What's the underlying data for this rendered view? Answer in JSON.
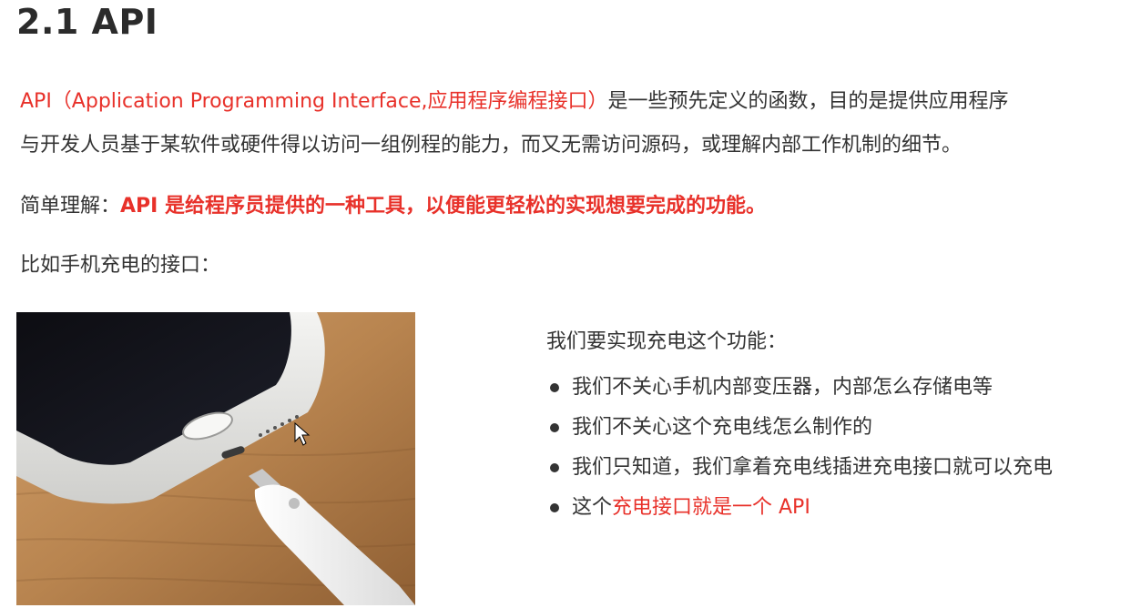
{
  "title": "2.1 API",
  "intro": {
    "highlight": "API（Application Programming Interface,应用程序编程接口）",
    "rest_line1": "是一些预先定义的函数，目的是提供应用程序",
    "line2": "与开发人员基于某软件或硬件得以访问一组例程的能力，而又无需访问源码，或理解内部工作机制的细节。"
  },
  "simple": {
    "label": "简单理解：",
    "emphasis": "API 是给程序员提供的一种工具，以便能更轻松的实现想要完成的功能。"
  },
  "example": "比如手机充电的接口：",
  "list": {
    "heading": "我们要实现充电这个功能：",
    "items": [
      "我们不关心手机内部变压器，内部怎么存储电等",
      "我们不关心这个充电线怎么制作的",
      "我们只知道，我们拿着充电线插进充电接口就可以充电"
    ],
    "last_item": {
      "prefix": "这个",
      "highlight": "充电接口就是一个 API"
    }
  },
  "colors": {
    "accent_red": "#e8312a",
    "text": "#333333",
    "title": "#2b2b2b"
  },
  "image": {
    "icon": "phone-charging-photo"
  }
}
